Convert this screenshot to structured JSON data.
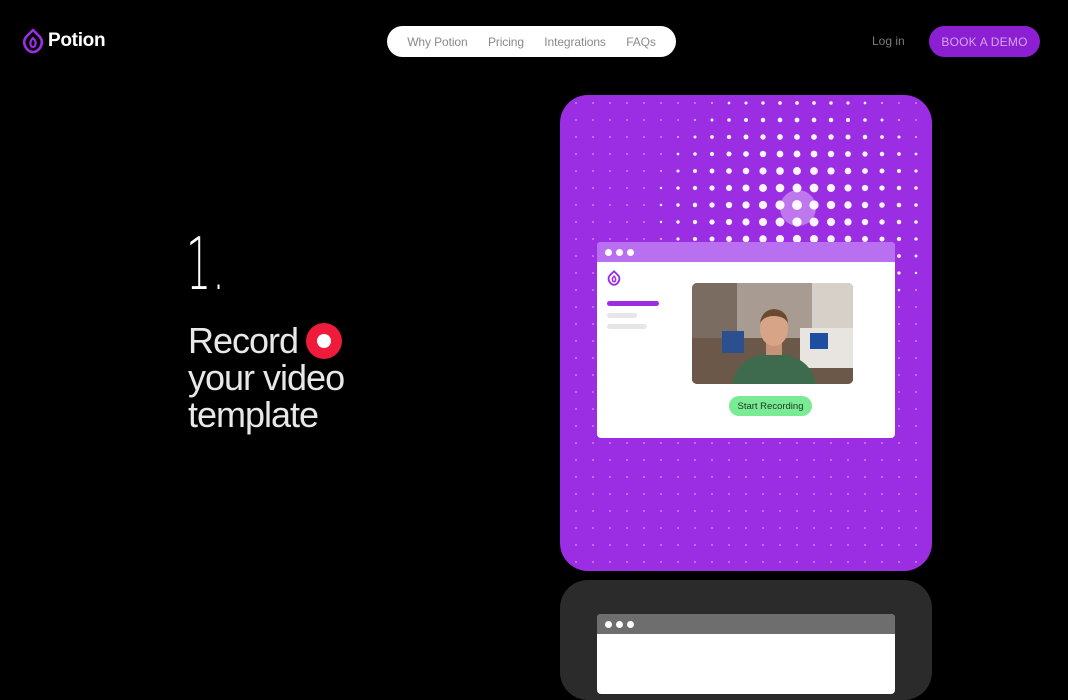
{
  "brand": {
    "name": "Potion",
    "color": "#9b2ee2"
  },
  "nav": {
    "items": [
      "Why Potion",
      "Pricing",
      "Integrations",
      "FAQs"
    ]
  },
  "header": {
    "login_label": "Log in",
    "demo_label": "BOOK A DEMO"
  },
  "hero": {
    "step_number": "1.",
    "line1": "Record",
    "line2": "your video",
    "line3": "template",
    "record_icon": "record-dot-icon"
  },
  "preview": {
    "start_recording_label": "Start Recording",
    "accent": "#9b2ee2",
    "button_color": "#7bea94"
  }
}
